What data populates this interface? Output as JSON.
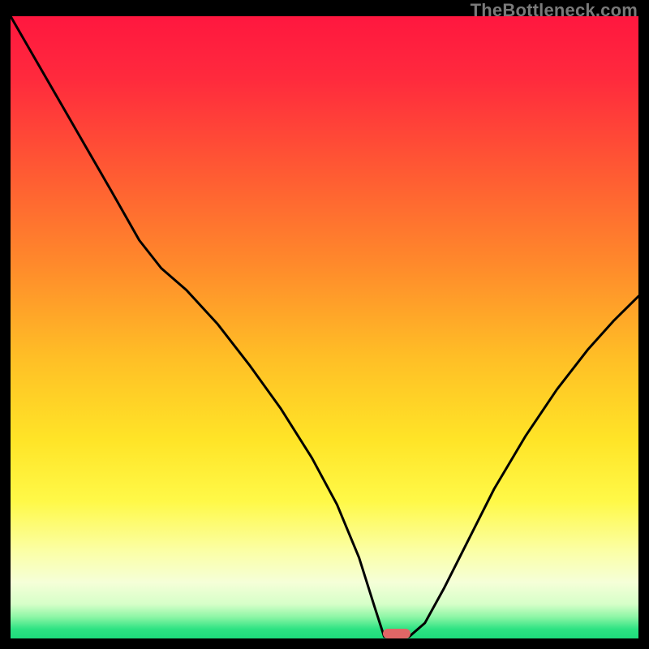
{
  "watermark": "TheBottleneck.com",
  "chart_data": {
    "type": "line",
    "title": "",
    "xlabel": "",
    "ylabel": "",
    "xlim": [
      0,
      100
    ],
    "ylim": [
      0,
      100
    ],
    "gradient_stops": [
      {
        "offset": 0.0,
        "color": "#ff173f"
      },
      {
        "offset": 0.1,
        "color": "#ff2a3d"
      },
      {
        "offset": 0.25,
        "color": "#ff5a33"
      },
      {
        "offset": 0.4,
        "color": "#ff8a2b"
      },
      {
        "offset": 0.55,
        "color": "#ffbf26"
      },
      {
        "offset": 0.68,
        "color": "#ffe427"
      },
      {
        "offset": 0.78,
        "color": "#fff948"
      },
      {
        "offset": 0.86,
        "color": "#fbffa6"
      },
      {
        "offset": 0.91,
        "color": "#f5ffd8"
      },
      {
        "offset": 0.945,
        "color": "#d6ffc8"
      },
      {
        "offset": 0.965,
        "color": "#8ff6a6"
      },
      {
        "offset": 0.985,
        "color": "#2de383"
      },
      {
        "offset": 1.0,
        "color": "#1edc7c"
      }
    ],
    "series": [
      {
        "name": "bottleneck-curve",
        "x": [
          0.0,
          4.0,
          8.0,
          12.0,
          16.0,
          20.5,
          24.0,
          28.0,
          33.0,
          38.0,
          43.0,
          48.0,
          52.0,
          55.5,
          58.0,
          59.5,
          63.5,
          66.0,
          69.0,
          73.0,
          77.0,
          82.0,
          87.0,
          92.0,
          96.0,
          100.0
        ],
        "y": [
          100.0,
          93.0,
          86.0,
          79.0,
          72.0,
          64.0,
          59.5,
          56.0,
          50.5,
          44.0,
          37.0,
          29.0,
          21.5,
          13.0,
          5.0,
          0.3,
          0.3,
          2.5,
          8.0,
          16.0,
          24.0,
          32.5,
          40.0,
          46.5,
          51.0,
          55.0
        ]
      }
    ],
    "marker": {
      "name": "optimal-point",
      "x_center": 61.5,
      "width_pct": 4.4,
      "y_bottom_pct": 0.0,
      "height_pct": 1.6,
      "color": "#e06666"
    }
  }
}
